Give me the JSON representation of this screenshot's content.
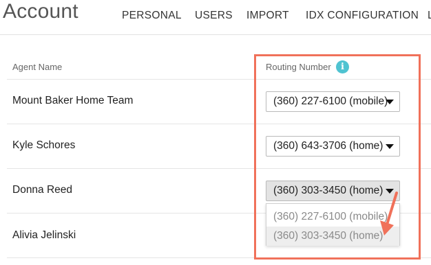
{
  "header": {
    "title": "Account",
    "tabs": [
      {
        "label": "PERSONAL"
      },
      {
        "label": "USERS"
      },
      {
        "label": "IMPORT"
      },
      {
        "label": "IDX CONFIGURATION"
      },
      {
        "label": "L"
      }
    ]
  },
  "table": {
    "columns": {
      "agent_name": "Agent Name",
      "routing_number": "Routing Number"
    },
    "rows": [
      {
        "agent": "Mount Baker Home Team",
        "routing": "(360) 227-6100 (mobile)"
      },
      {
        "agent": "Kyle Schores",
        "routing": "(360) 643-3706 (home)"
      },
      {
        "agent": "Donna Reed",
        "routing": "(360) 303-3450 (home)"
      },
      {
        "agent": "Alivia Jelinski",
        "routing": ""
      }
    ]
  },
  "dropdown": {
    "options": [
      {
        "label": "(360) 227-6100 (mobile)"
      },
      {
        "label": "(360) 303-3450 (home)"
      }
    ]
  },
  "icons": {
    "info": "info-icon",
    "caret": "chevron-down-icon",
    "pointer": "arrow-annotation"
  },
  "colors": {
    "highlight": "#f0715a",
    "info_icon": "#4fc3d1"
  }
}
